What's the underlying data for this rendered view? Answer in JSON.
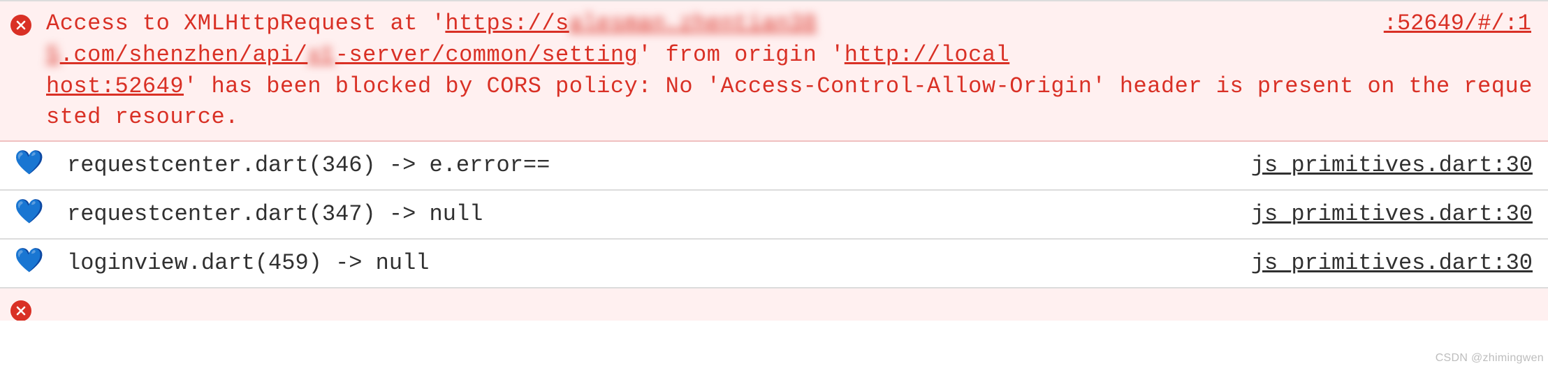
{
  "error": {
    "text_pre": "Access to XMLHttpRequest at '",
    "url_display_1": "https://s████████████████",
    "url_display_2": "█.com/shenzhen/api/██-server/common/setting",
    "text_mid1": "' from origin '",
    "origin_url": "http://localhost:52649",
    "text_post": "' has been blocked by CORS policy: No 'Access-Control-Allow-Origin' header is present on the requested resource.",
    "topright": ":52649/#/:1"
  },
  "logs": [
    {
      "icon": "💙",
      "text": "requestcenter.dart(346) -> e.error==",
      "src": "js_primitives.dart:30"
    },
    {
      "icon": "💙",
      "text": "requestcenter.dart(347) -> null",
      "src": "js_primitives.dart:30"
    },
    {
      "icon": "💙",
      "text": "loginview.dart(459) -> null",
      "src": "js_primitives.dart:30"
    }
  ],
  "watermark": "CSDN @zhimingwen"
}
